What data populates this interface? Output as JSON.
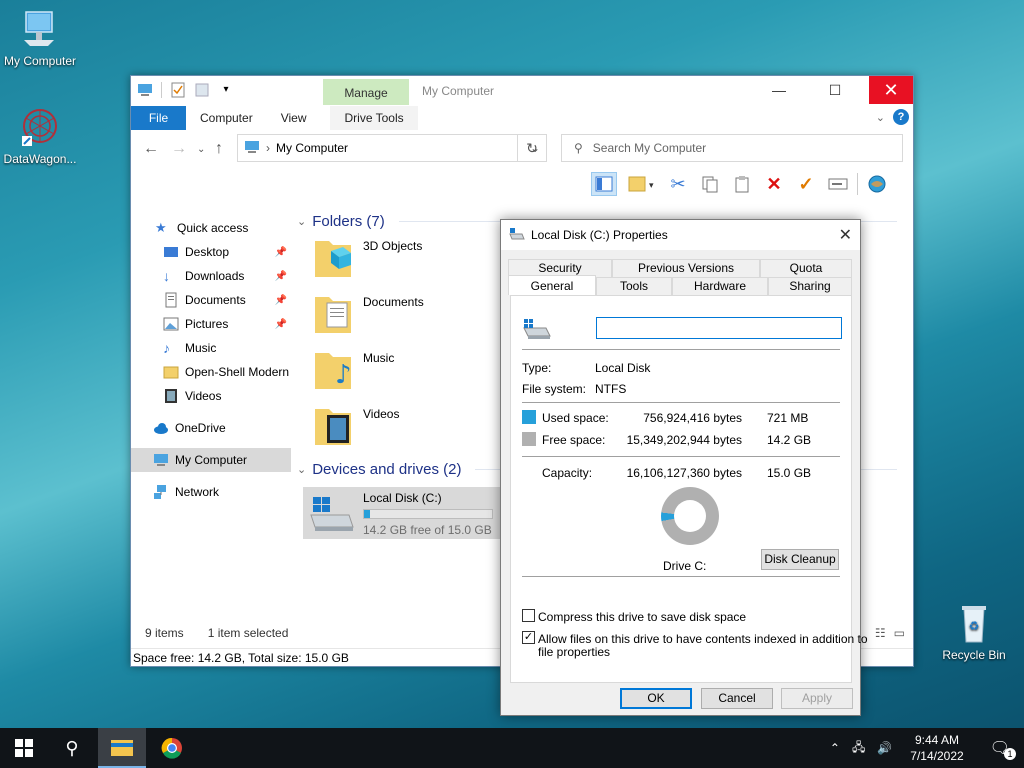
{
  "desktop": {
    "icons": [
      {
        "label": "My Computer"
      },
      {
        "label": "DataWagon..."
      },
      {
        "label": "Recycle Bin"
      }
    ]
  },
  "explorer": {
    "window_title": "My Computer",
    "manage_tab": "Manage",
    "ribbon_tabs": [
      "File",
      "Computer",
      "View",
      "Drive Tools"
    ],
    "address": "My Computer",
    "search_placeholder": "Search My Computer",
    "sidebar": {
      "quick_access": "Quick access",
      "items": [
        {
          "label": "Desktop",
          "pinned": true
        },
        {
          "label": "Downloads",
          "pinned": true
        },
        {
          "label": "Documents",
          "pinned": true
        },
        {
          "label": "Pictures",
          "pinned": true
        },
        {
          "label": "Music",
          "pinned": false
        },
        {
          "label": "Open-Shell Modern",
          "pinned": false
        },
        {
          "label": "Videos",
          "pinned": false
        }
      ],
      "onedrive": "OneDrive",
      "my_computer": "My Computer",
      "network": "Network"
    },
    "folders_header": "Folders (7)",
    "folders": [
      {
        "name": "3D Objects"
      },
      {
        "name": "Documents"
      },
      {
        "name": "Music"
      },
      {
        "name": "Videos"
      }
    ],
    "devices_header": "Devices and drives (2)",
    "drive": {
      "name": "Local Disk (C:)",
      "free_text": "14.2 GB free of 15.0 GB",
      "used_fraction": 0.047
    },
    "status": {
      "items": "9 items",
      "selected": "1 item selected",
      "space": "Space free: 14.2 GB, Total size: 15.0 GB"
    }
  },
  "properties": {
    "title": "Local Disk (C:) Properties",
    "tabs_row1": [
      "Security",
      "Previous Versions",
      "Quota"
    ],
    "tabs_row2": [
      "General",
      "Tools",
      "Hardware",
      "Sharing"
    ],
    "name_value": "",
    "type_label": "Type:",
    "type_value": "Local Disk",
    "fs_label": "File system:",
    "fs_value": "NTFS",
    "used_label": "Used space:",
    "used_bytes": "756,924,416 bytes",
    "used_size": "721 MB",
    "free_label": "Free space:",
    "free_bytes": "15,349,202,944 bytes",
    "free_size": "14.2 GB",
    "capacity_label": "Capacity:",
    "capacity_bytes": "16,106,127,360 bytes",
    "capacity_size": "15.0 GB",
    "drive_label": "Drive C:",
    "disk_cleanup": "Disk Cleanup",
    "compress_label": "Compress this drive to save disk space",
    "compress_checked": false,
    "index_label_line1": "Allow files on this drive to have contents indexed in addition to",
    "index_label_line2": "file properties",
    "index_checked": true,
    "ok": "OK",
    "cancel": "Cancel",
    "apply": "Apply",
    "used_color": "#26a0da",
    "free_color": "#b0b0b0",
    "used_fraction": 0.047
  },
  "taskbar": {
    "time": "9:44 AM",
    "date": "7/14/2022",
    "notification_count": "1"
  }
}
